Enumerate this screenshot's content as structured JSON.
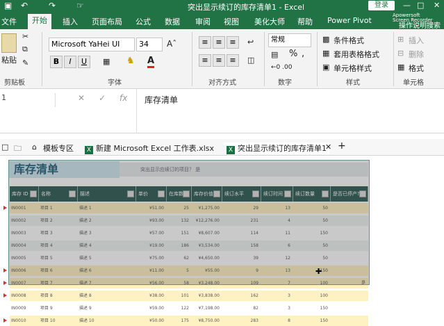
{
  "titlebar": {
    "title": "突出显示续订的库存清单1  -  Excel",
    "login": "登录",
    "icons": [
      "save-icon",
      "undo-icon",
      "redo-icon",
      "touch-icon",
      "minimize-icon",
      "restore-icon",
      "close-icon"
    ]
  },
  "ribbon_tabs": [
    "文件",
    "开始",
    "插入",
    "页面布局",
    "公式",
    "数据",
    "审阅",
    "视图",
    "美化大师",
    "帮助",
    "Power Pivot"
  ],
  "active_tab": "开始",
  "tell_me": "操作说明搜索",
  "recorder_watermark": [
    "Apowersoft",
    "Screen Recorder"
  ],
  "ribbon": {
    "paste": "粘贴",
    "clipboard": "剪贴板",
    "font_name": "Microsoft YaHei UI",
    "font_size": "34",
    "bold": "B",
    "italic": "I",
    "underline": "U",
    "font_color_glyph": "A",
    "font_group": "字体",
    "align_group": "对齐方式",
    "number_format": "常规",
    "percent": "%",
    "comma": ",",
    "number_group": "数字",
    "conditional": "条件格式",
    "table_format": "套用表格格式",
    "cell_styles": "单元格样式",
    "styles_group": "样式",
    "insert": "插入",
    "delete": "删除",
    "format": "格式",
    "cells_group": "单元格"
  },
  "formula_bar": {
    "name_box": "1",
    "fx": "fx",
    "content": "库存清单"
  },
  "doc_tabs": [
    "模板专区",
    "新建 Microsoft Excel 工作表.xlsx",
    "突出显示续订的库存清单1"
  ],
  "sheet": {
    "title": "库存清单",
    "hint": "突出显示应续订的项目？  是",
    "headers": [
      "库存 ID",
      "名称",
      "描述",
      "单价",
      "在库数量",
      "库存价值",
      "续订水平",
      "续订时间",
      "续订数量",
      "是否已停产?"
    ],
    "rows": [
      {
        "id": "IN0001",
        "name": "项目 1",
        "desc": "描述 1",
        "price": "¥51.00",
        "qty": "25",
        "value": "¥1,275.00",
        "level": "29",
        "time": "13",
        "reqty": "50",
        "disc": "",
        "mark": true
      },
      {
        "id": "IN0002",
        "name": "项目 2",
        "desc": "描述 2",
        "price": "¥93.00",
        "qty": "132",
        "value": "¥12,276.00",
        "level": "231",
        "time": "4",
        "reqty": "50",
        "disc": "",
        "mark": false
      },
      {
        "id": "IN0003",
        "name": "项目 3",
        "desc": "描述 3",
        "price": "¥57.00",
        "qty": "151",
        "value": "¥8,607.00",
        "level": "114",
        "time": "11",
        "reqty": "150",
        "disc": "",
        "mark": false
      },
      {
        "id": "IN0004",
        "name": "项目 4",
        "desc": "描述 4",
        "price": "¥19.00",
        "qty": "186",
        "value": "¥3,534.00",
        "level": "158",
        "time": "6",
        "reqty": "50",
        "disc": "",
        "mark": false
      },
      {
        "id": "IN0005",
        "name": "项目 5",
        "desc": "描述 5",
        "price": "¥75.00",
        "qty": "62",
        "value": "¥4,650.00",
        "level": "39",
        "time": "12",
        "reqty": "50",
        "disc": "",
        "mark": false
      },
      {
        "id": "IN0006",
        "name": "项目 6",
        "desc": "描述 6",
        "price": "¥11.00",
        "qty": "5",
        "value": "¥55.00",
        "level": "9",
        "time": "13",
        "reqty": "150",
        "disc": "",
        "mark": true
      },
      {
        "id": "IN0007",
        "name": "项目 7",
        "desc": "描述 7",
        "price": "¥56.00",
        "qty": "58",
        "value": "¥3,248.00",
        "level": "109",
        "time": "7",
        "reqty": "100",
        "disc": "是",
        "mark": true
      },
      {
        "id": "IN0008",
        "name": "项目 8",
        "desc": "描述 8",
        "price": "¥38.00",
        "qty": "101",
        "value": "¥3,838.00",
        "level": "162",
        "time": "3",
        "reqty": "100",
        "disc": "",
        "mark": true
      },
      {
        "id": "IN0009",
        "name": "项目 9",
        "desc": "描述 9",
        "price": "¥59.00",
        "qty": "122",
        "value": "¥7,198.00",
        "level": "82",
        "time": "3",
        "reqty": "150",
        "disc": "",
        "mark": false
      },
      {
        "id": "IN0010",
        "name": "项目 10",
        "desc": "描述 10",
        "price": "¥50.00",
        "qty": "175",
        "value": "¥8,750.00",
        "level": "283",
        "time": "8",
        "reqty": "150",
        "disc": "",
        "mark": true
      }
    ]
  },
  "colors": {
    "excel_green": "#217346",
    "header": "#2d5a52",
    "highlight": "#fff2c2",
    "title_bg": "#cfe6ef"
  }
}
